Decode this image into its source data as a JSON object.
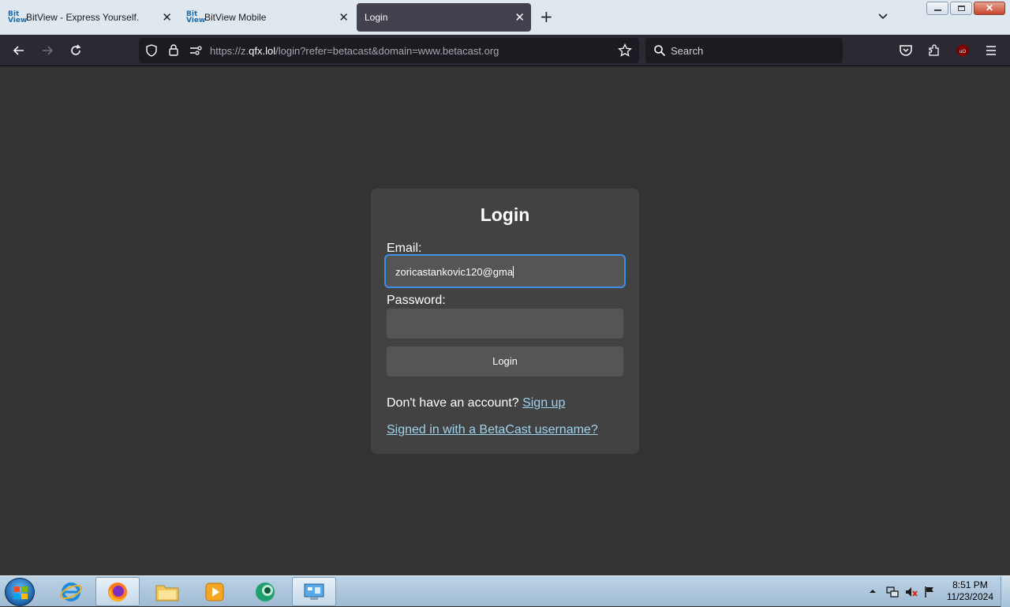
{
  "browser": {
    "tabs": [
      {
        "title": "BitView - Express Yourself.",
        "favicon": "bitview-icon",
        "favicon_text": [
          "Bit",
          "View"
        ],
        "active": false
      },
      {
        "title": "BitView Mobile",
        "favicon": "bitview-icon",
        "favicon_text": [
          "Bit",
          "View"
        ],
        "active": false
      },
      {
        "title": "Login",
        "favicon": "",
        "active": true
      }
    ],
    "url_prefix": "https://z.",
    "url_domain": "qfx.lol",
    "url_rest": "/login?refer=betacast&domain=www.betacast.org",
    "search_placeholder": "Search",
    "close_glyph": "✕"
  },
  "page": {
    "title": "Login",
    "email_label": "Email:",
    "email_value": "zoricastankovic120@gma",
    "password_label": "Password:",
    "password_value": "",
    "login_button": "Login",
    "signup_prompt": "Don't have an account?",
    "signup_link": "Sign up",
    "betacast_link": "Signed in with a BetaCast username?"
  },
  "taskbar": {
    "time": "8:51 PM",
    "date": "11/23/2024"
  },
  "colors": {
    "page_bg": "#333333",
    "card_bg": "#424242",
    "input_bg": "#555555",
    "focus_ring": "#3d8fe8",
    "link": "#9fd3ec"
  }
}
